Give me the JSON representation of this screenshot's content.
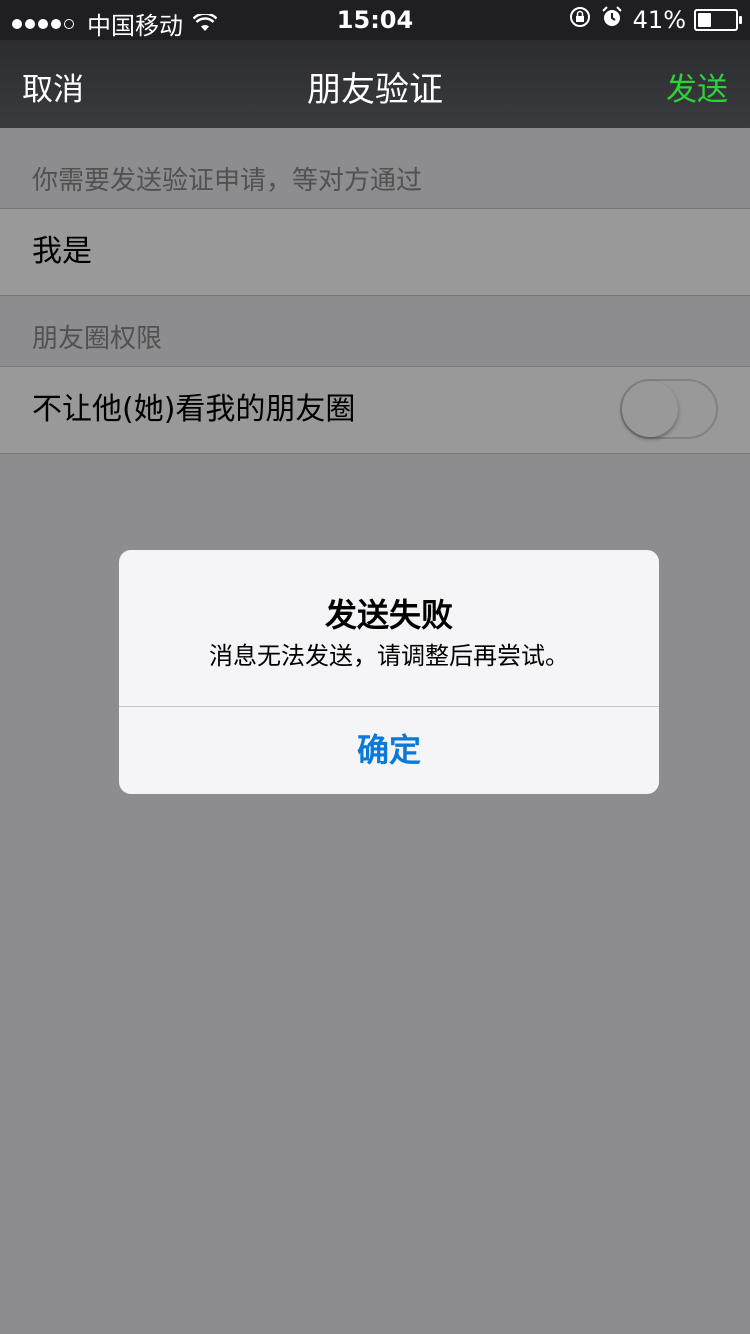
{
  "status_bar": {
    "carrier": "中国移动",
    "time": "15:04",
    "battery": "41%",
    "battery_level": 0.41
  },
  "nav": {
    "cancel_label": "取消",
    "title": "朋友验证",
    "send_label": "发送"
  },
  "form": {
    "verify_header": "你需要发送验证申请，等对方通过",
    "message_value": "我是",
    "moments_header": "朋友圈权限",
    "block_moments_label": "不让他(她)看我的朋友圈",
    "block_moments_on": false
  },
  "alert": {
    "title": "发送失败",
    "message": "消息无法发送，请调整后再尝试。",
    "ok_label": "确定"
  },
  "colors": {
    "accent_green": "#2fd13a",
    "alert_button_blue": "#0a79d8"
  },
  "icons": [
    "signal-dots-icon",
    "wifi-icon",
    "orientation-lock-icon",
    "alarm-icon",
    "battery-icon",
    "toggle-switch"
  ]
}
